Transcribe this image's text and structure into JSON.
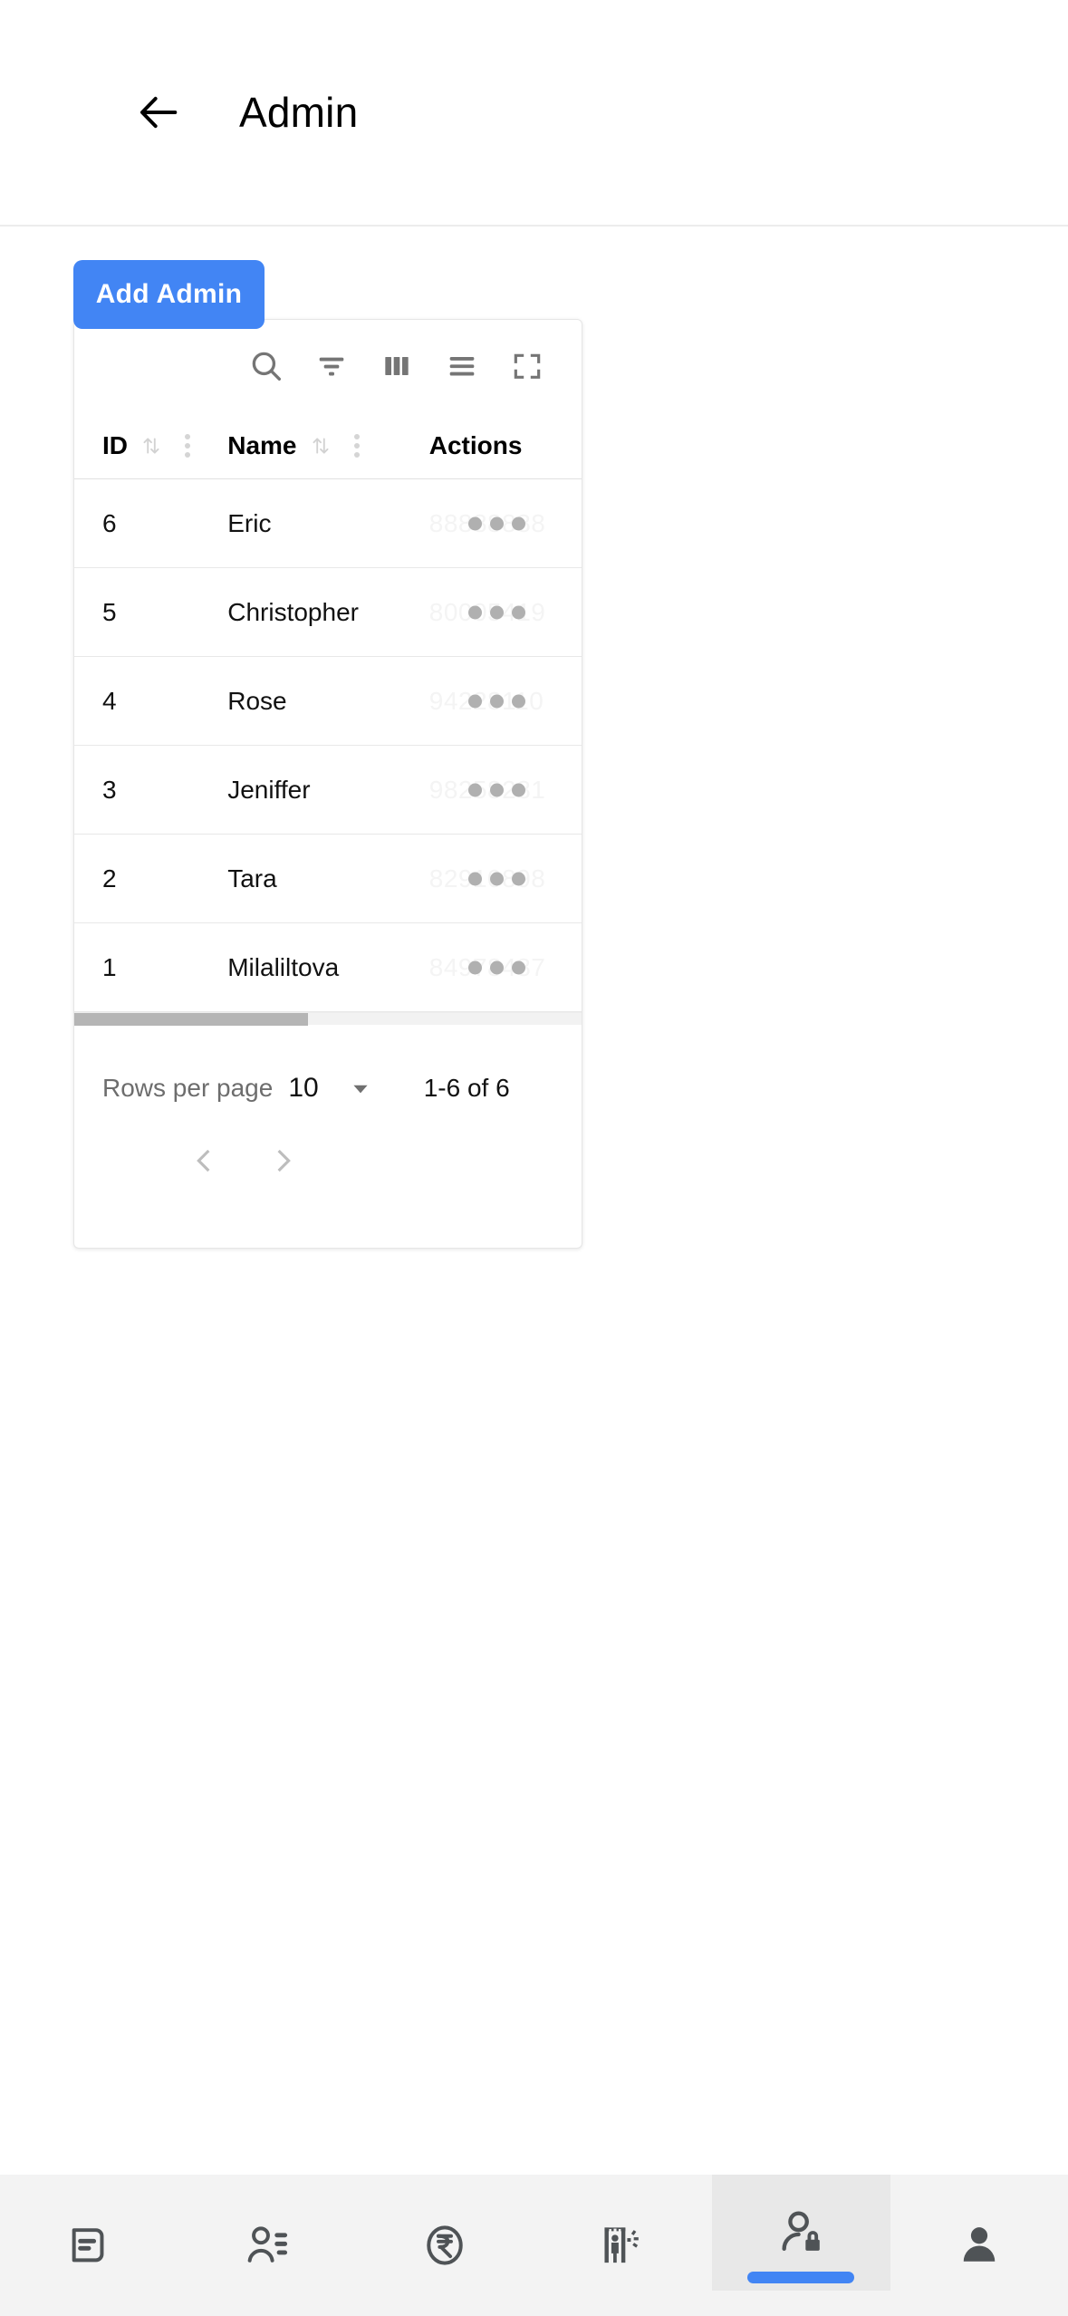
{
  "appbar": {
    "back_icon": "arrow-left-icon",
    "title": "Admin"
  },
  "actions": {
    "add_admin_label": "Add Admin"
  },
  "toolbar": {
    "icons": [
      {
        "name": "search-icon",
        "label": "Search"
      },
      {
        "name": "filter-icon",
        "label": "Filter"
      },
      {
        "name": "columns-icon",
        "label": "Columns"
      },
      {
        "name": "density-icon",
        "label": "Density"
      },
      {
        "name": "fullscreen-icon",
        "label": "Fullscreen"
      }
    ]
  },
  "table": {
    "columns": [
      {
        "key": "id",
        "label": "ID",
        "sortable": true,
        "menu": true
      },
      {
        "key": "name",
        "label": "Name",
        "sortable": true,
        "menu": true
      },
      {
        "key": "actions",
        "label": "Actions",
        "sortable": false,
        "menu": false
      }
    ],
    "rows": [
      {
        "id": "6",
        "name": "Eric",
        "phone": "88888888"
      },
      {
        "id": "5",
        "name": "Christopher",
        "phone": "80005419"
      },
      {
        "id": "4",
        "name": "Rose",
        "phone": "94228110"
      },
      {
        "id": "3",
        "name": "Jeniffer",
        "phone": "98258281"
      },
      {
        "id": "2",
        "name": "Tara",
        "phone": "82910898"
      },
      {
        "id": "1",
        "name": "Milaliltova",
        "phone": "84978487"
      }
    ]
  },
  "pagination": {
    "rows_per_page_label": "Rows per page",
    "rows_per_page_value": "10",
    "range_label": "1-6 of 6",
    "prev_icon": "chevron-left-icon",
    "next_icon": "chevron-right-icon",
    "dropdown_icon": "caret-down-icon"
  },
  "bottom_nav": {
    "items": [
      {
        "name": "notes-icon",
        "label": "Notes",
        "active": false
      },
      {
        "name": "user-list-icon",
        "label": "Members",
        "active": false
      },
      {
        "name": "rupee-icon",
        "label": "Payments",
        "active": false
      },
      {
        "name": "security-scanner-icon",
        "label": "Scanner",
        "active": false
      },
      {
        "name": "admin-lock-icon",
        "label": "Admin",
        "active": true
      },
      {
        "name": "profile-icon",
        "label": "Profile",
        "active": false
      }
    ]
  },
  "colors": {
    "accent": "#4285f4",
    "icon_gray": "#757575",
    "nav_icon": "#4f5356",
    "nav_bg": "#f3f3f3"
  }
}
